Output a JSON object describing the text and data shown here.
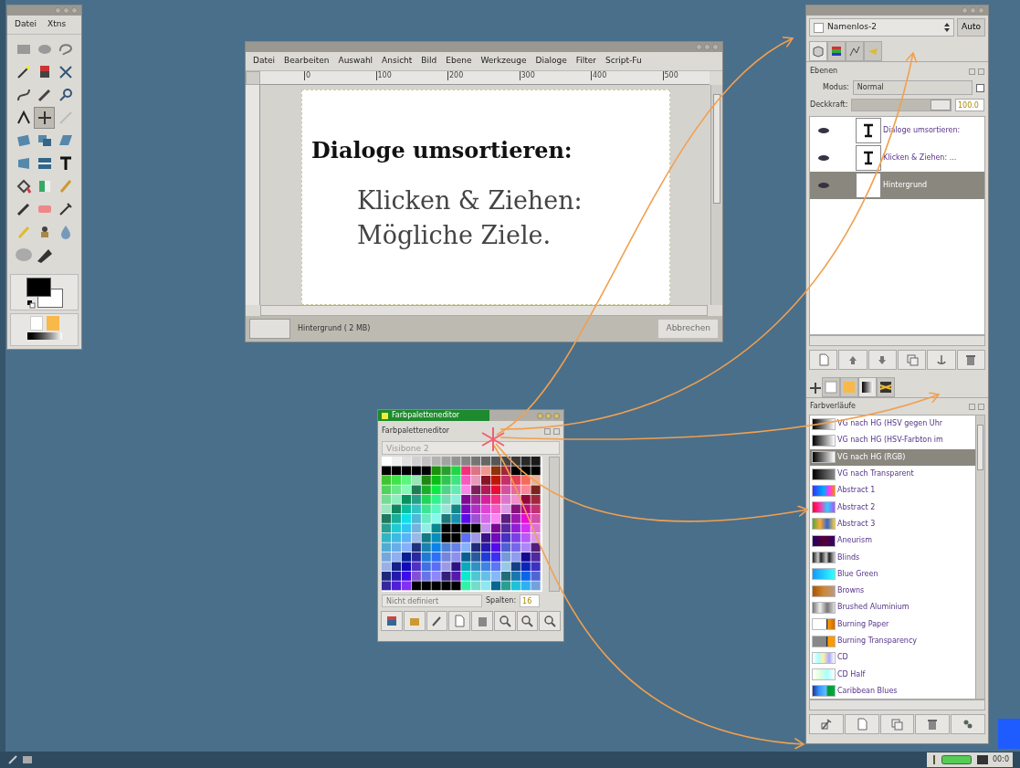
{
  "toolbox": {
    "menu": [
      "Datei",
      "Xtns"
    ],
    "tools": [
      {
        "selected": false
      },
      {
        "selected": false
      },
      {
        "selected": false
      },
      {
        "selected": false
      },
      {
        "selected": false
      },
      {
        "selected": false
      },
      {
        "selected": false
      },
      {
        "selected": false
      },
      {
        "selected": false
      },
      {
        "selected": false
      },
      {
        "selected": true
      },
      {
        "selected": false
      },
      {
        "selected": false
      },
      {
        "selected": false
      },
      {
        "selected": false
      },
      {
        "selected": false
      },
      {
        "selected": false
      },
      {
        "selected": false
      },
      {
        "selected": false
      },
      {
        "selected": false
      },
      {
        "selected": false
      },
      {
        "selected": false
      },
      {
        "selected": false
      },
      {
        "selected": false
      },
      {
        "selected": false
      },
      {
        "selected": false
      },
      {
        "selected": false
      },
      {
        "selected": false
      },
      {
        "selected": false
      }
    ]
  },
  "image_window": {
    "menu": [
      "Datei",
      "Bearbeiten",
      "Auswahl",
      "Ansicht",
      "Bild",
      "Ebene",
      "Werkzeuge",
      "Dialoge",
      "Filter",
      "Script-Fu"
    ],
    "ruler_ticks": [
      "0",
      "100",
      "200",
      "300",
      "400",
      "500"
    ],
    "heading": "Dialoge umsortieren:",
    "lines": [
      "Klicken & Ziehen:",
      "Mögliche Ziele."
    ],
    "status": "Hintergrund ( 2 MB)",
    "cancel": {
      "label": "Abbrechen",
      "disabled": true
    }
  },
  "palette_editor": {
    "title": "Farbpaletteneditor",
    "header": "Farbpaletteneditor",
    "palette_name": "Visibone 2",
    "color_name_placeholder": "Nicht definiert",
    "columns_label": "Spalten:",
    "columns_value": "16"
  },
  "dock": {
    "image_combo": "Namenlos-2",
    "auto_button": "Auto",
    "tabs": [
      {
        "selected": true
      },
      {
        "selected": false
      },
      {
        "selected": false
      },
      {
        "selected": false
      }
    ],
    "layers_title": "Ebenen",
    "mode_label": "Modus:",
    "mode_value": "Normal",
    "mode_checkbox": {
      "checked": false
    },
    "opacity_label": "Deckkraft:",
    "opacity": {
      "level": 1.0
    },
    "opacity_value": "100.0",
    "layers": [
      {
        "name": "Dialoge umsortieren:",
        "selected": false
      },
      {
        "name": "Klicken & Ziehen: ...",
        "selected": false
      },
      {
        "name": "Hintergrund",
        "selected": true
      }
    ],
    "lower_tabs": [
      {
        "selected": false
      },
      {
        "selected": false
      },
      {
        "selected": true
      },
      {
        "selected": false
      }
    ],
    "gradients_title": "Farbverläufe",
    "gradients": [
      {
        "name": "VG nach HG (HSV gegen Uhr",
        "selected": false
      },
      {
        "name": "VG nach HG (HSV-Farbton im",
        "selected": false
      },
      {
        "name": "VG nach HG (RGB)",
        "selected": true
      },
      {
        "name": "VG nach Transparent",
        "selected": false
      },
      {
        "name": "Abstract 1",
        "selected": false
      },
      {
        "name": "Abstract 2",
        "selected": false
      },
      {
        "name": "Abstract 3",
        "selected": false
      },
      {
        "name": "Aneurism",
        "selected": false
      },
      {
        "name": "Blinds",
        "selected": false
      },
      {
        "name": "Blue Green",
        "selected": false
      },
      {
        "name": "Browns",
        "selected": false
      },
      {
        "name": "Brushed Aluminium",
        "selected": false
      },
      {
        "name": "Burning Paper",
        "selected": false
      },
      {
        "name": "Burning Transparency",
        "selected": false
      },
      {
        "name": "CD",
        "selected": false
      },
      {
        "name": "CD Half",
        "selected": false
      },
      {
        "name": "Caribbean Blues",
        "selected": false
      }
    ]
  },
  "taskbar": {
    "clock": "00:0"
  }
}
